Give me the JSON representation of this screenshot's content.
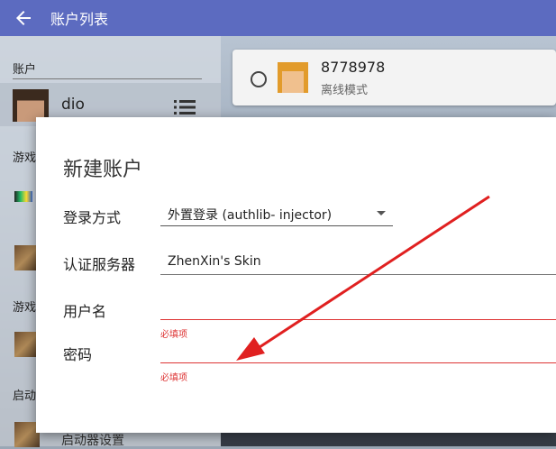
{
  "titlebar": {
    "title": "账户列表"
  },
  "sidebar": {
    "header": "账户",
    "account": {
      "name": "dio"
    },
    "labels": {
      "game1": "游戏",
      "game2": "游戏",
      "launch": "启动"
    },
    "bottom_item": "启动器设置"
  },
  "account_card": {
    "name": "8778978",
    "mode": "离线模式"
  },
  "dialog": {
    "title": "新建账户",
    "login_label": "登录方式",
    "login_value": "外置登录 (authlib- injector)",
    "server_label": "认证服务器",
    "server_value": "ZhenXin's Skin",
    "username_label": "用户名",
    "password_label": "密码",
    "required_text": "必填项"
  },
  "colors": {
    "accent": "#5c6bc0",
    "error": "#dd3333",
    "arrow": "#e02020"
  }
}
